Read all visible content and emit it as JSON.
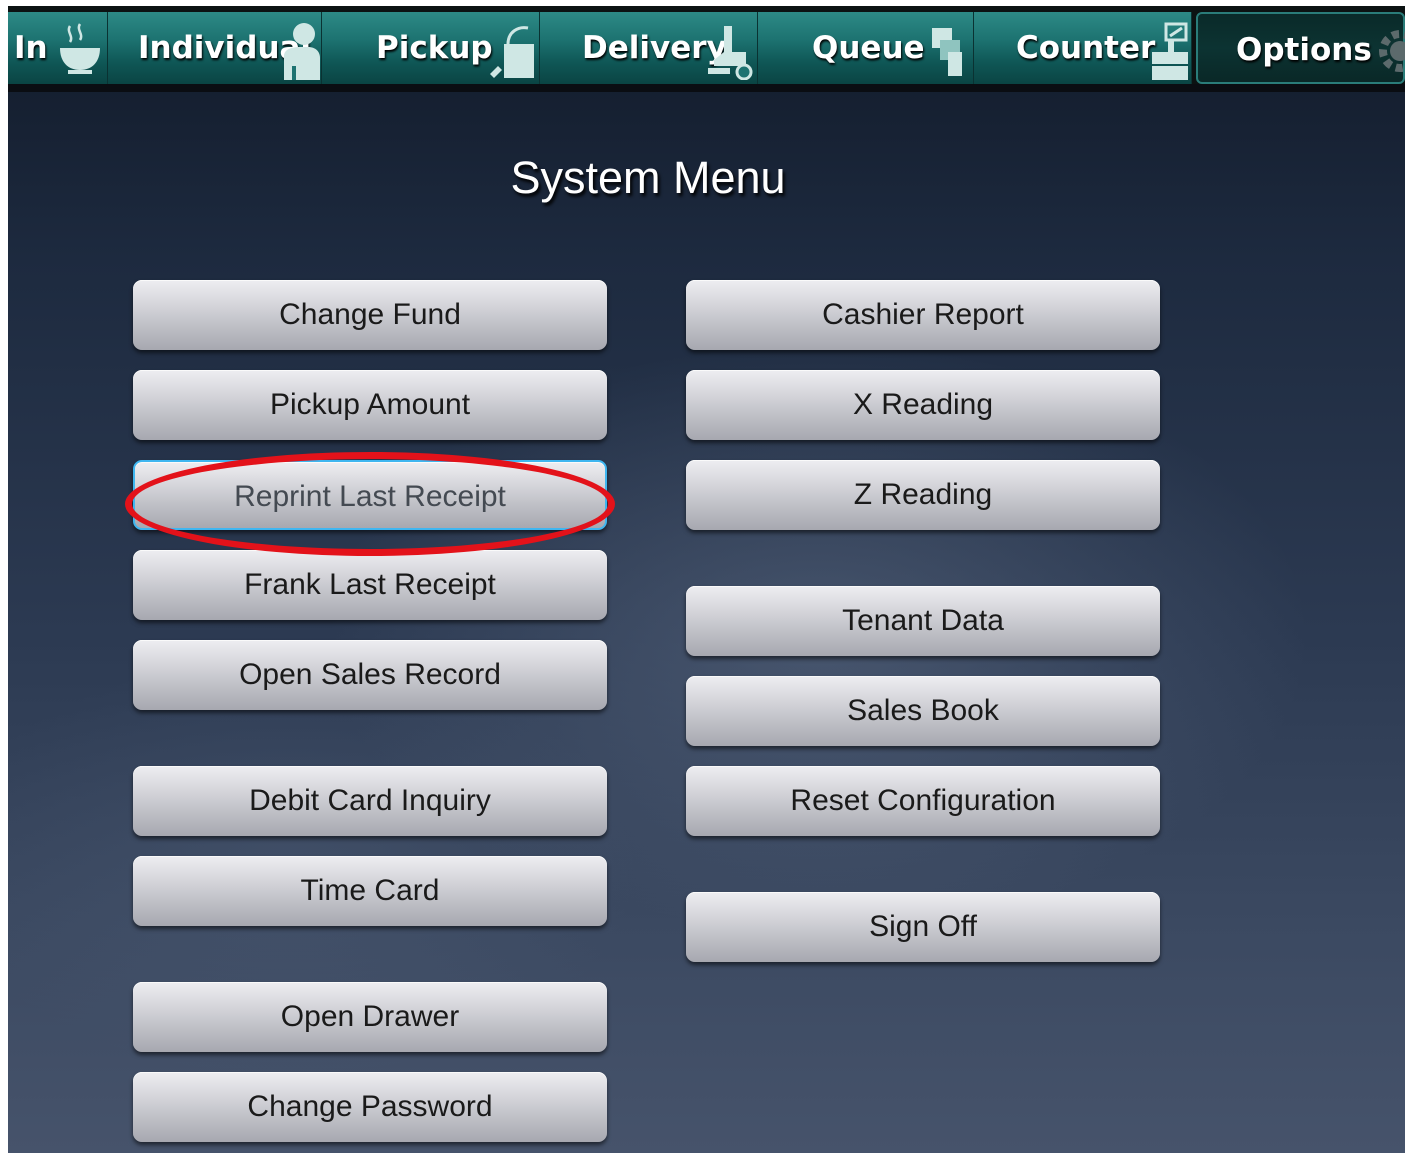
{
  "tabs": [
    {
      "label": "In",
      "icon": "steaming-bowl-icon",
      "active": false
    },
    {
      "label": "Individual",
      "icon": "person-icon",
      "active": false
    },
    {
      "label": "Pickup",
      "icon": "bag-icon",
      "active": false
    },
    {
      "label": "Delivery",
      "icon": "delivery-icon",
      "active": false
    },
    {
      "label": "Queue",
      "icon": "queue-icon",
      "active": false
    },
    {
      "label": "Counter",
      "icon": "register-icon",
      "active": false
    },
    {
      "label": "Options",
      "icon": "gear-icon",
      "active": true
    }
  ],
  "title": "System Menu",
  "left_buttons": [
    "Change Fund",
    "Pickup Amount",
    "Reprint Last Receipt",
    "Frank Last Receipt",
    "Open Sales Record",
    "Debit Card Inquiry",
    "Time Card",
    "Open Drawer",
    "Change Password"
  ],
  "right_buttons": [
    "Cashier Report",
    "X Reading",
    "Z Reading",
    "Tenant Data",
    "Sales Book",
    "Reset Configuration",
    "Sign Off"
  ],
  "highlighted_button": "Reprint Last Receipt",
  "colors": {
    "tab": "#1d7371",
    "highlight_ring": "#e3121a",
    "focus_border": "#3fb6f0"
  }
}
